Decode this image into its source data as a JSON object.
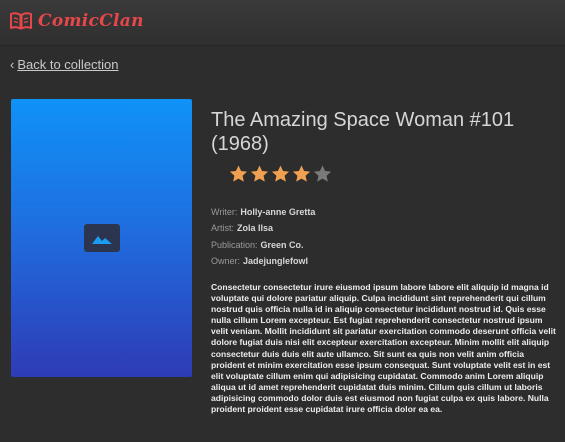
{
  "header": {
    "brand_name": "ComicClan",
    "brand_color": "#e5474a",
    "brand_icon": "open-book-icon"
  },
  "nav": {
    "back_label": "Back to collection",
    "back_icon": "chevron-left-icon"
  },
  "comic": {
    "cover_icon": "image-placeholder-icon",
    "cover_gradient": [
      "#0f92f7",
      "#2e3bb6"
    ],
    "title": "The Amazing Space Woman #101 (1968)",
    "rating": 4,
    "rating_max": 5,
    "star_color": "#f0a050",
    "star_empty_color": "#7a7a7a",
    "meta": [
      {
        "key": "Writer:",
        "value": "Holly-anne Gretta"
      },
      {
        "key": "Artist:",
        "value": "Zola Ilsa"
      },
      {
        "key": "Publication:",
        "value": "Green Co."
      },
      {
        "key": "Owner:",
        "value": "Jadejunglefowl"
      }
    ],
    "description": "Consectetur consectetur irure eiusmod ipsum labore labore elit aliquip id magna id voluptate qui dolore pariatur aliquip. Culpa incididunt sint reprehenderit qui cillum nostrud quis officia nulla id in aliquip consectetur incididunt nostrud id. Quis esse nulla cillum Lorem excepteur. Est fugiat reprehenderit consectetur nostrud ipsum velit veniam. Mollit incididunt sit pariatur exercitation commodo deserunt officia velit dolore fugiat duis nisi elit excepteur exercitation excepteur. Minim mollit elit aliquip consectetur duis duis elit aute ullamco. Sit sunt ea quis non velit anim officia proident et minim exercitation esse ipsum consequat. Sunt voluptate velit est in est elit voluptate cillum enim qui adipisicing cupidatat. Commodo anim Lorem aliquip aliqua ut id amet reprehenderit cupidatat duis minim. Cillum quis cillum ut laboris adipisicing commodo dolor duis est eiusmod non fugiat culpa ex quis labore. Nulla proident proident esse cupidatat irure officia dolor ea ea."
  }
}
